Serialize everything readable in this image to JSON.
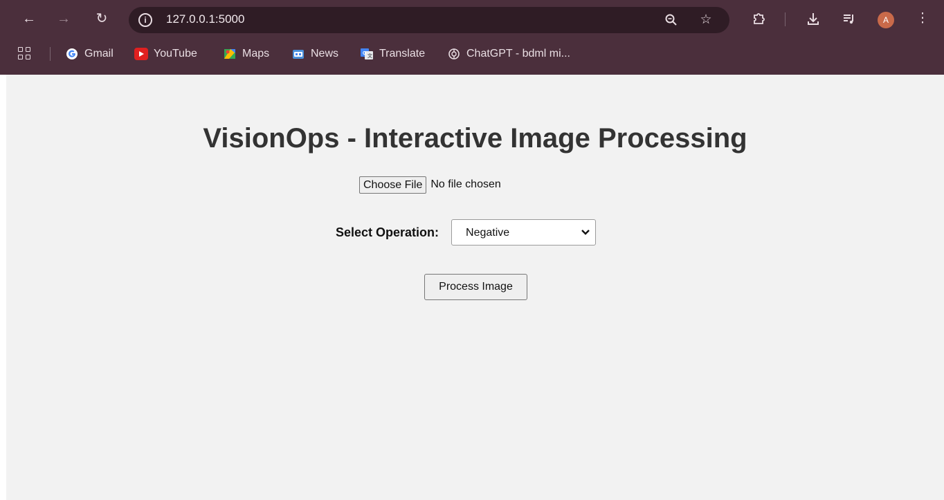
{
  "browser": {
    "url": "127.0.0.1:5000",
    "profile_initial": "A",
    "bookmarks": [
      {
        "label": "Gmail",
        "icon": "gmail-icon"
      },
      {
        "label": "YouTube",
        "icon": "youtube-icon"
      },
      {
        "label": "Maps",
        "icon": "maps-icon"
      },
      {
        "label": "News",
        "icon": "news-icon"
      },
      {
        "label": "Translate",
        "icon": "translate-icon"
      },
      {
        "label": "ChatGPT - bdml mi...",
        "icon": "chatgpt-icon"
      }
    ],
    "colors": {
      "frame": "#4b2f3c",
      "omnibox": "#2f1c25"
    }
  },
  "page": {
    "title": "VisionOps - Interactive Image Processing",
    "file_input": {
      "button_label": "Choose File",
      "status": "No file chosen"
    },
    "operation": {
      "label": "Select Operation:",
      "selected": "Negative"
    },
    "submit_label": "Process Image",
    "colors": {
      "background": "#f2f2f2",
      "title": "#333333"
    }
  }
}
